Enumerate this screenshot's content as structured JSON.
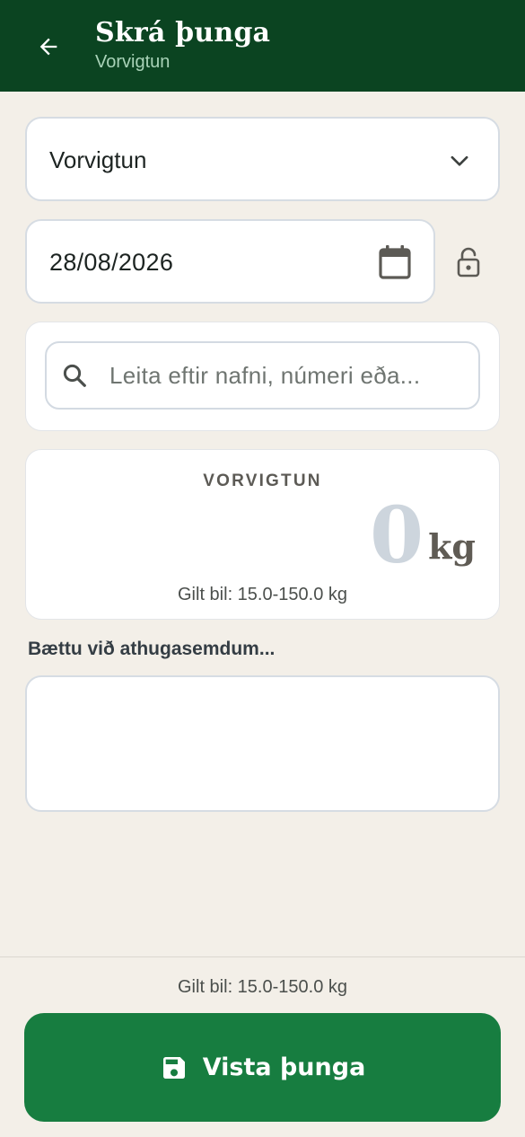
{
  "header": {
    "title": "Skrá þunga",
    "subtitle": "Vorvigtun",
    "back_icon": "arrow-left-icon"
  },
  "form": {
    "weighing_type": {
      "value": "Vorvigtun",
      "icon": "chevron-down-icon"
    },
    "date": {
      "value": "28/08/2026",
      "icon": "calendar-icon",
      "lock_icon": "lock-open-icon"
    },
    "search": {
      "placeholder": "Leita eftir nafni, númeri eða...",
      "icon": "search-icon"
    },
    "weight": {
      "label": "VORVIGTUN",
      "value": "0",
      "unit": "kg",
      "range_text": "Gilt bil: 15.0-150.0 kg"
    },
    "notes": {
      "label": "Bættu við athugasemdum...",
      "value": ""
    }
  },
  "footer": {
    "range_text": "Gilt bil: 15.0-150.0 kg",
    "save_label": "Vista þunga",
    "save_icon": "save-icon"
  },
  "colors": {
    "header_bg": "#0b4421",
    "primary": "#177d40",
    "background": "#f3efe8",
    "weight_placeholder": "#cdd5dd"
  }
}
